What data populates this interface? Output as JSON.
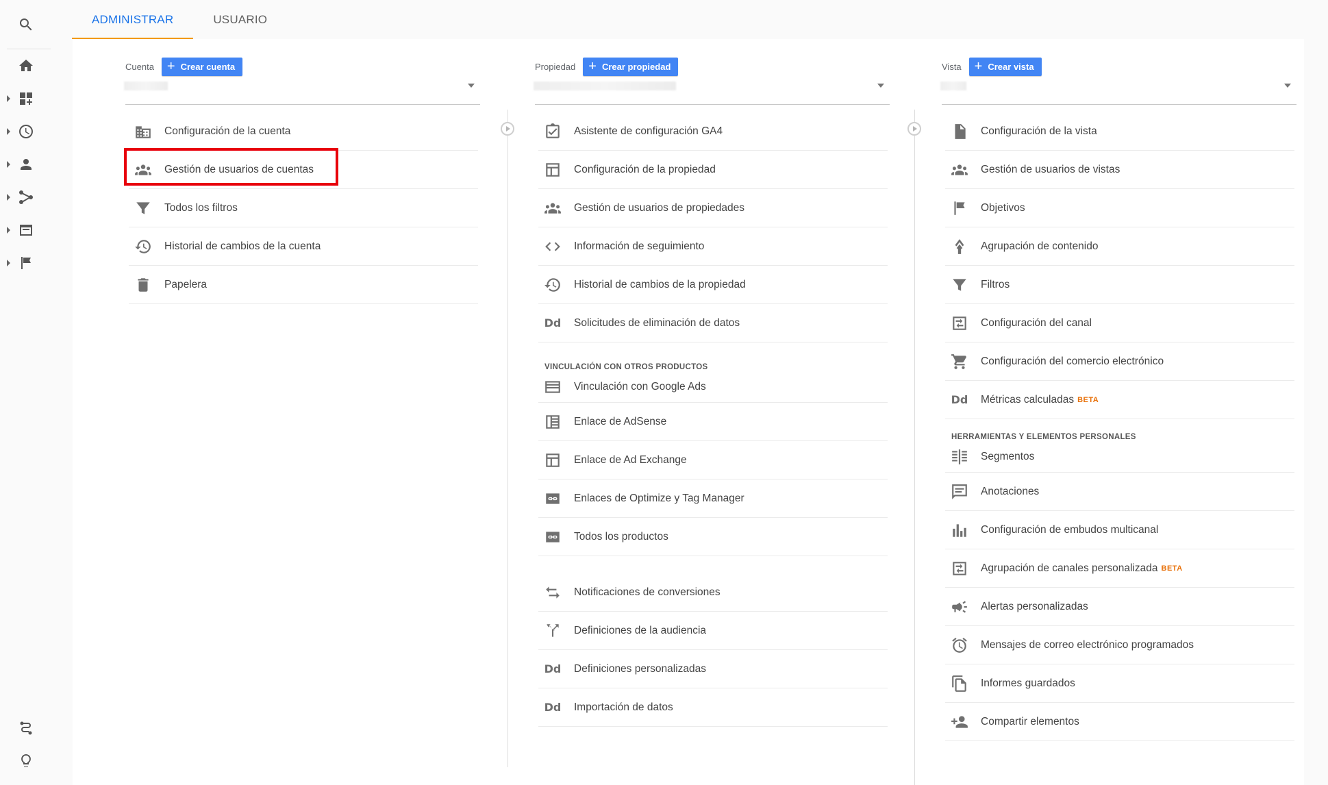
{
  "tabs": [
    {
      "label": "ADMINISTRAR",
      "active": true
    },
    {
      "label": "USUARIO",
      "active": false
    }
  ],
  "rail": {
    "items": [
      "search-icon",
      "home-icon",
      "customization-icon",
      "realtime-icon",
      "audience-icon",
      "acquisition-icon",
      "behavior-icon",
      "conversions-icon",
      "attribution-icon",
      "discover-icon"
    ]
  },
  "account": {
    "label": "Cuenta",
    "create_label": "Crear cuenta",
    "items": [
      {
        "icon": "building-icon",
        "label": "Configuración de la cuenta"
      },
      {
        "icon": "users-icon",
        "label": "Gestión de usuarios de cuentas"
      },
      {
        "icon": "filter-icon",
        "label": "Todos los filtros"
      },
      {
        "icon": "history-icon",
        "label": "Historial de cambios de la cuenta"
      },
      {
        "icon": "trash-icon",
        "label": "Papelera"
      }
    ]
  },
  "property": {
    "label": "Propiedad",
    "create_label": "Crear propiedad",
    "items": [
      {
        "icon": "checklist-icon",
        "label": "Asistente de configuración GA4"
      },
      {
        "icon": "layout-icon",
        "label": "Configuración de la propiedad"
      },
      {
        "icon": "users-icon",
        "label": "Gestión de usuarios de propiedades"
      },
      {
        "icon": "code-icon",
        "label": "Información de seguimiento"
      },
      {
        "icon": "history-icon",
        "label": "Historial de cambios de la propiedad"
      },
      {
        "icon": "dd-icon",
        "label": "Solicitudes de eliminación de datos"
      }
    ],
    "section_title": "VINCULACIÓN CON OTROS PRODUCTOS",
    "linking": [
      {
        "icon": "ads-icon",
        "label": "Vinculación con Google Ads"
      },
      {
        "icon": "adsense-icon",
        "label": "Enlace de AdSense"
      },
      {
        "icon": "layout-icon",
        "label": "Enlace de Ad Exchange"
      },
      {
        "icon": "link-icon",
        "label": "Enlaces de Optimize y Tag Manager"
      },
      {
        "icon": "link-icon",
        "label": "Todos los productos"
      }
    ],
    "more": [
      {
        "icon": "swap-icon",
        "label": "Notificaciones de conversiones"
      },
      {
        "icon": "fork-icon",
        "label": "Definiciones de la audiencia"
      },
      {
        "icon": "dd-icon",
        "label": "Definiciones personalizadas"
      },
      {
        "icon": "dd-icon",
        "label": "Importación de datos"
      }
    ]
  },
  "view": {
    "label": "Vista",
    "create_label": "Crear vista",
    "items": [
      {
        "icon": "doc-icon",
        "label": "Configuración de la vista"
      },
      {
        "icon": "users-icon",
        "label": "Gestión de usuarios de vistas"
      },
      {
        "icon": "flag-icon",
        "label": "Objetivos"
      },
      {
        "icon": "person-walk-icon",
        "label": "Agrupación de contenido"
      },
      {
        "icon": "filter-icon",
        "label": "Filtros"
      },
      {
        "icon": "channel-icon",
        "label": "Configuración del canal"
      },
      {
        "icon": "cart-icon",
        "label": "Configuración del comercio electrónico"
      },
      {
        "icon": "dd-icon",
        "label": "Métricas calculadas",
        "badge": "BETA"
      }
    ],
    "section_title": "HERRAMIENTAS Y ELEMENTOS PERSONALES",
    "tools": [
      {
        "icon": "segments-icon",
        "label": "Segmentos"
      },
      {
        "icon": "comment-icon",
        "label": "Anotaciones"
      },
      {
        "icon": "bars-icon",
        "label": "Configuración de embudos multicanal"
      },
      {
        "icon": "channel-icon",
        "label": "Agrupación de canales personalizada",
        "badge": "BETA"
      },
      {
        "icon": "megaphone-icon",
        "label": "Alertas personalizadas"
      },
      {
        "icon": "alarm-icon",
        "label": "Mensajes de correo electrónico programados"
      },
      {
        "icon": "saved-doc-icon",
        "label": "Informes guardados"
      },
      {
        "icon": "person-add-icon",
        "label": "Compartir elementos"
      }
    ]
  },
  "colors": {
    "accent": "#1a73e8",
    "button": "#4285f4",
    "tab_underline": "#f29900",
    "highlight": "#e8000b",
    "beta": "#e8710a"
  }
}
